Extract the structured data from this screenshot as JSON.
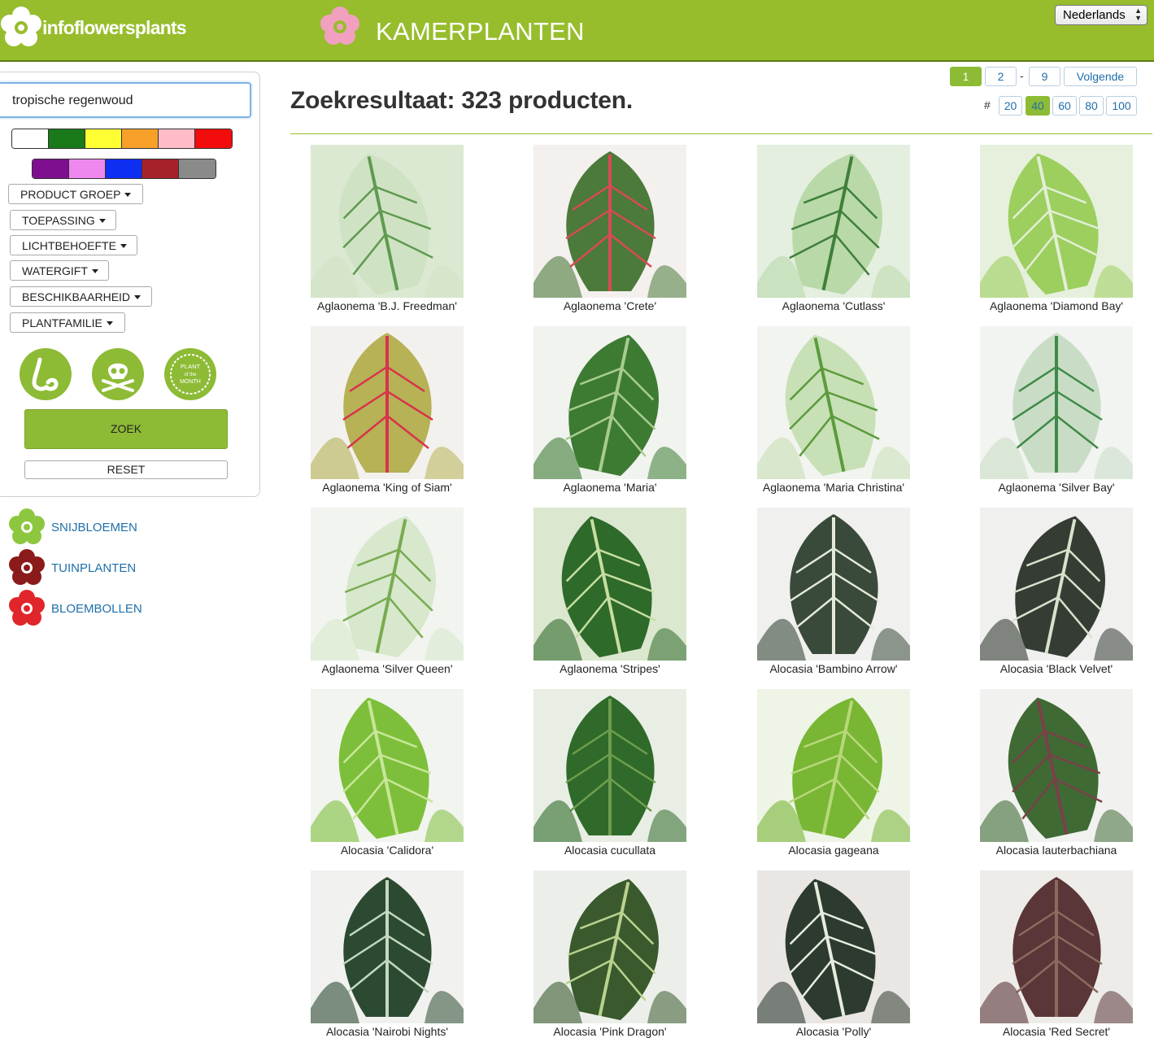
{
  "header": {
    "logo_text": "infoflowersplants",
    "category_title": "KAMERPLANTEN",
    "language": "Nederlands"
  },
  "search": {
    "value": "tropische regenwoud"
  },
  "colors": {
    "row1": [
      "#ffffff",
      "#1a7a1a",
      "#ffff33",
      "#f7a12a",
      "#ffbcc8",
      "#f20c0c"
    ],
    "row2": [
      "#7e0f8f",
      "#ee88ee",
      "#0e2ef2",
      "#a5222a",
      "#8a8a8a"
    ],
    "brand_green": "#97bd2c"
  },
  "filters": [
    "PRODUCT GROEP",
    "TOEPASSING",
    "LICHTBEHOEFTE",
    "WATERGIFT",
    "BESCHIKBAARHEID",
    "PLANTFAMILIE"
  ],
  "round_icons": [
    {
      "icon": "nose-icon"
    },
    {
      "icon": "skull-crossbones-icon"
    },
    {
      "icon": "plant-of-the-month-icon",
      "lines": [
        "PLANT",
        "of the",
        "MONTH"
      ]
    }
  ],
  "buttons": {
    "search": "ZOEK",
    "reset": "RESET"
  },
  "side_links": [
    {
      "label": "SNIJBLOEMEN",
      "color": "#8dc63f"
    },
    {
      "label": "TUINPLANTEN",
      "color": "#8b1a1a"
    },
    {
      "label": "BLOEMBOLLEN",
      "color": "#e0262a"
    }
  ],
  "results": {
    "title": "Zoekresultaat: 323 producten."
  },
  "pagination": {
    "pages": [
      "1",
      "2",
      "9"
    ],
    "separator": "-",
    "next": "Volgende",
    "current": "1"
  },
  "per_page": {
    "label": "#",
    "options": [
      "20",
      "40",
      "60",
      "80",
      "100"
    ],
    "current": "40"
  },
  "products": [
    {
      "name": "Aglaonema 'B.J. Freedman'",
      "base": "#dbe9d2",
      "leaf": "#cfe3c4",
      "vein": "#5f9a50"
    },
    {
      "name": "Aglaonema 'Crete'",
      "base": "#f4f0ee",
      "leaf": "#4b7a3a",
      "vein": "#d94a55"
    },
    {
      "name": "Aglaonema 'Cutlass'",
      "base": "#e4efe0",
      "leaf": "#b9d9a8",
      "vein": "#3f7f3a"
    },
    {
      "name": "Aglaonema 'Diamond Bay'",
      "base": "#e6f0dc",
      "leaf": "#9ccf5e",
      "vein": "#e3eed6"
    },
    {
      "name": "Aglaonema 'King of Siam'",
      "base": "#f3f1ee",
      "leaf": "#b6b255",
      "vein": "#d8334c"
    },
    {
      "name": "Aglaonema 'Maria'",
      "base": "#f1f3ef",
      "leaf": "#3d7b33",
      "vein": "#a8cc8f"
    },
    {
      "name": "Aglaonema 'Maria Christina'",
      "base": "#f2f4ef",
      "leaf": "#c8e0b6",
      "vein": "#5b9b3c"
    },
    {
      "name": "Aglaonema 'Silver Bay'",
      "base": "#f2f4f1",
      "leaf": "#c9ddc6",
      "vein": "#3f8a48"
    },
    {
      "name": "Aglaonema 'Silver Queen'",
      "base": "#f2f4f0",
      "leaf": "#d7e8cc",
      "vein": "#79ab52"
    },
    {
      "name": "Aglaonema 'Stripes'",
      "base": "#dbe7cf",
      "leaf": "#2e6a2a",
      "vein": "#c6dea0"
    },
    {
      "name": "Alocasia 'Bambino Arrow'",
      "base": "#f0f0ee",
      "leaf": "#3a4a3a",
      "vein": "#e4ead8"
    },
    {
      "name": "Alocasia 'Black Velvet'",
      "base": "#f0f0ee",
      "leaf": "#343c34",
      "vein": "#d8e2cc"
    },
    {
      "name": "Alocasia 'Calidora'",
      "base": "#f2f4ef",
      "leaf": "#7dbf3a",
      "vein": "#c8e69a"
    },
    {
      "name": "Alocasia cucullata",
      "base": "#e8eee4",
      "leaf": "#2f6a2a",
      "vein": "#6f9d4e"
    },
    {
      "name": "Alocasia gageana",
      "base": "#eef4e6",
      "leaf": "#78b634",
      "vein": "#b8d87a"
    },
    {
      "name": "Alocasia lauterbachiana",
      "base": "#f1f2ef",
      "leaf": "#3f6a34",
      "vein": "#7a4048"
    },
    {
      "name": "Alocasia 'Nairobi Nights'",
      "base": "#f1f2ef",
      "leaf": "#2c4a32",
      "vein": "#c4d8c0"
    },
    {
      "name": "Alocasia 'Pink Dragon'",
      "base": "#ecefe9",
      "leaf": "#3a5a2e",
      "vein": "#b9d28e"
    },
    {
      "name": "Alocasia 'Polly'",
      "base": "#e9e6e3",
      "leaf": "#2d3a30",
      "vein": "#e6ecde"
    },
    {
      "name": "Alocasia 'Red Secret'",
      "base": "#eeece9",
      "leaf": "#5a3638",
      "vein": "#8c6a5e"
    }
  ]
}
